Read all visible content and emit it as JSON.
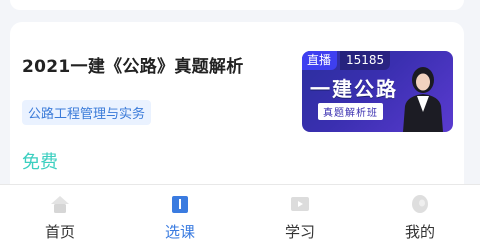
{
  "course": {
    "title": "2021一建《公路》真题解析",
    "tag": "公路工程管理与实务",
    "price": "免费",
    "thumbnail": {
      "live_label": "直播",
      "views": "15185",
      "headline": "一建公路",
      "subtitle": "真题解析班"
    }
  },
  "tabbar": {
    "items": [
      {
        "label": "首页",
        "icon": "home-icon",
        "active": false
      },
      {
        "label": "选课",
        "icon": "book-icon",
        "active": true
      },
      {
        "label": "学习",
        "icon": "video-icon",
        "active": false
      },
      {
        "label": "我的",
        "icon": "profile-icon",
        "active": false
      }
    ]
  },
  "colors": {
    "accent": "#3a7be0",
    "price": "#3ccfc0",
    "tag_bg": "#eaf2ff"
  }
}
